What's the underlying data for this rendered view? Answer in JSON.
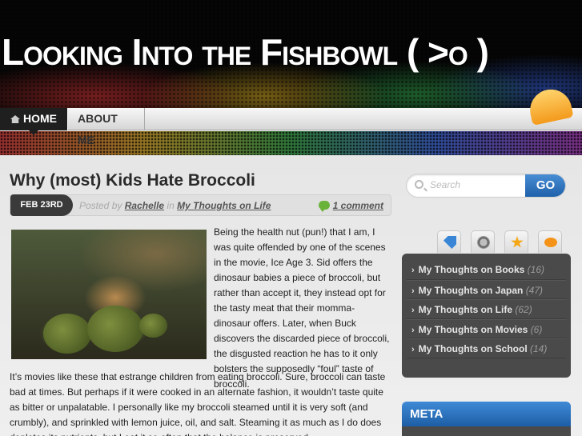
{
  "site": {
    "title": "Looking Into the Fishbowl ( >o )"
  },
  "nav": {
    "items": [
      {
        "label": "Home"
      },
      {
        "label": "About Me"
      }
    ]
  },
  "post": {
    "title": "Why (most) Kids Hate Broccoli",
    "date": "Feb 23rd",
    "posted_by": "Posted by",
    "author": "Rachelle",
    "in": "in",
    "category": "My Thoughts on Life",
    "comments": "1 comment",
    "paragraph1": "Being the health nut (pun!) that I am, I was quite offended by one of the scenes in the movie, Ice Age 3. Sid offers the dinosaur babies a piece of broccoli, but rather than accept it, they instead opt for the tasty meat that their momma-dinosaur offers. Later, when Buck discovers the discarded piece of broccoli, the disgusted reaction he has to it only bolsters the supposedly “foul” taste of broccoli.",
    "paragraph2": "It’s movies like these that estrange children from eating broccoli. Sure, broccoli can taste bad at times. But perhaps if it were cooked in an alternate fashion, it wouldn’t taste quite as bitter or unpalatable. I personally like my broccoli steamed until it is very soft (and crumbly), and sprinkled with lemon juice, oil, and salt. Steaming it as much as I do does depletes its nutrients, but I eat it so often that the balance is preserved."
  },
  "sidebar": {
    "search": {
      "placeholder": "Search",
      "button": "GO"
    },
    "tabs": [
      "tag-icon",
      "clock-icon",
      "star-icon",
      "chat-icon"
    ],
    "categories": [
      {
        "name": "My Thoughts on Books",
        "count": "(16)"
      },
      {
        "name": "My Thoughts on Japan",
        "count": "(47)"
      },
      {
        "name": "My Thoughts on Life",
        "count": "(62)"
      },
      {
        "name": "My Thoughts on Movies",
        "count": "(6)"
      },
      {
        "name": "My Thoughts on School",
        "count": "(14)"
      }
    ],
    "meta_title": "META"
  },
  "colors": {
    "accent_blue": "#1d5fa8",
    "comment_green": "#6ab23a",
    "panel_dark": "#4a4a4a"
  }
}
